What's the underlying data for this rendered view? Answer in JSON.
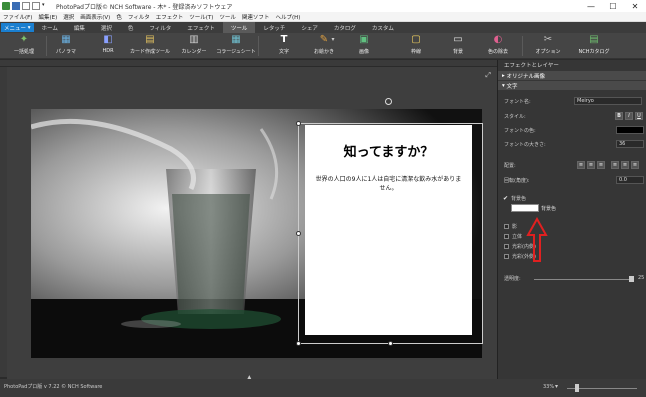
{
  "titlebar": {
    "title": "PhotoPadプロ版© NCH Software - 木* - 登録済みソフトウェア",
    "minimize": "—",
    "maximize": "☐",
    "close": "✕"
  },
  "menubar": [
    "ファイル(F)",
    "編集(E)",
    "選択",
    "画面表示(V)",
    "色",
    "フィルタ",
    "エフェクト",
    "ツール(T)",
    "ツール",
    "関連ソフト",
    "ヘルプ(H)"
  ],
  "tabs": {
    "menu": "メニュー",
    "items": [
      "ホーム",
      "編集",
      "選択",
      "色",
      "フィルタ",
      "エフェクト",
      "ツール",
      "レタッチ",
      "シェア",
      "カタログ",
      "カスタム"
    ],
    "active_index": 6
  },
  "toolbar": [
    {
      "label": "一括処理",
      "icon": "batch-icon"
    },
    {
      "label": "パノラマ",
      "icon": "panorama-icon"
    },
    {
      "label": "HDR",
      "icon": "hdr-icon"
    },
    {
      "label": "カード作成ツール",
      "icon": "card-icon"
    },
    {
      "label": "カレンダー",
      "icon": "calendar-icon"
    },
    {
      "label": "コラージュシート",
      "icon": "collage-icon"
    },
    {
      "label": "文字",
      "icon": "text-icon"
    },
    {
      "label": "お絵かき",
      "icon": "brush-icon"
    },
    {
      "label": "画像",
      "icon": "image-icon"
    },
    {
      "label": "枠線",
      "icon": "frame-icon"
    },
    {
      "label": "背景",
      "icon": "background-icon"
    },
    {
      "label": "色の除去",
      "icon": "color-remove-icon"
    },
    {
      "label": "オプション",
      "icon": "options-icon"
    },
    {
      "label": "NCHカタログ",
      "icon": "catalog-icon"
    }
  ],
  "canvas": {
    "heading": "知ってますか？",
    "body": "世界の人口の9人に1人は自宅に清潔な飲み水がありません。"
  },
  "status": {
    "text": "PhotoPadプロ版 v 7.22 © NCH Software",
    "zoom": "33%"
  },
  "panel": {
    "header": "エフェクトとレイヤー",
    "sections": {
      "original": "オリジナル画像",
      "text": "文字"
    },
    "font_name_label": "フォント名:",
    "font_name_value": "Meiryo",
    "style_label": "スタイル:",
    "style_buttons": [
      "B",
      "I",
      "U"
    ],
    "font_color_label": "フォントの色:",
    "font_size_label": "フォントの大きさ:",
    "font_size_value": "36",
    "align_label": "配置:",
    "rotate_label": "回転(角度):",
    "rotate_value": "0.0",
    "bg_color_checkbox": "背景色",
    "bg_color_field": "背景色",
    "options": [
      "影",
      "立体",
      "光彩(内側)",
      "光彩(外側)"
    ],
    "opacity_label": "透明度:",
    "opacity_value": "25"
  },
  "colors": {
    "accent_blue": "#1a7fd0",
    "annotation_red": "#e02020",
    "bg_swatch": "#ffffff",
    "font_swatch": "#000000"
  }
}
